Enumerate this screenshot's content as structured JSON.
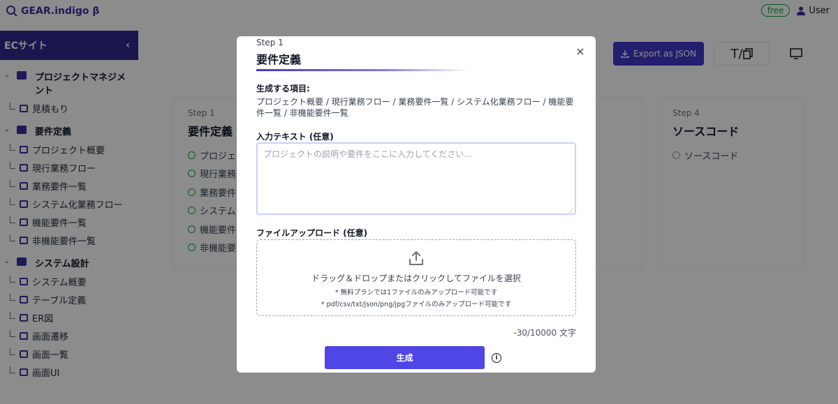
{
  "app": {
    "name": "GEAR.indigo β",
    "plan_badge": "free",
    "user_label": "User"
  },
  "sidebar": {
    "project_name": "ECサイト",
    "groups": [
      {
        "label": "プロジェクトマネジメント",
        "items": [
          "見積もり"
        ]
      },
      {
        "label": "要件定義",
        "items": [
          "プロジェクト概要",
          "現行業務フロー",
          "業務要件一覧",
          "システム化業務フロー",
          "機能要件一覧",
          "非機能要件一覧"
        ]
      },
      {
        "label": "システム設計",
        "items": [
          "システム概要",
          "テーブル定義",
          "ER図",
          "画面遷移",
          "画面一覧",
          "画面UI"
        ]
      }
    ]
  },
  "toolbar": {
    "export_label": "Export as JSON",
    "text_tool_label": "T/"
  },
  "cards": [
    {
      "step": "Step 1",
      "title": "要件定義",
      "rows": [
        "プロジェ",
        "現行業務",
        "業務要件",
        "システム",
        "機能要件",
        "非機能要"
      ]
    },
    {
      "step": "Step 4",
      "title": "ソースコード",
      "rows": [
        "ソースコード"
      ]
    }
  ],
  "modal": {
    "step": "Step 1",
    "title": "要件定義",
    "close_label": "×",
    "generate_items_label": "生成する項目:",
    "generate_items": "プロジェクト概要 / 現行業務フロー / 業務要件一覧 / システム化業務フロー / 機能要件一覧 / 非機能要件一覧",
    "input_label": "入力テキスト (任意)",
    "input_placeholder": "プロジェクトの説明や要件をここに入力してください...",
    "input_value": "",
    "upload_label": "ファイルアップロード (任意)",
    "dropzone_text": "ドラッグ＆ドロップまたはクリックしてファイルを選択",
    "dropzone_note1": "* 無料プランでは1ファイルのみアップロード可能です",
    "dropzone_note2": "* pdf/csv/txt/json/png/jpgファイルのみアップロード可能です",
    "char_count": "-30/10000 文字",
    "generate_button": "生成",
    "info_label": "i"
  },
  "colors": {
    "accent": "#4f46e5",
    "sidebar_header": "#2e2a8f",
    "badge_green": "#16a34a"
  }
}
